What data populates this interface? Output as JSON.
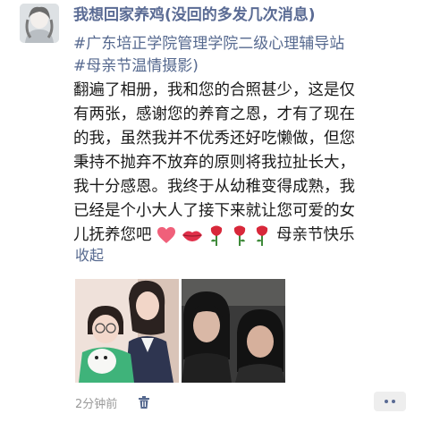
{
  "post": {
    "author": "我想回家养鸡(没回的多发几次消息)",
    "tags": [
      "#广东培正学院管理学院二级心理辅导站",
      "#母亲节温情摄影)"
    ],
    "body_lines": [
      "翻遍了相册，我和您的合照甚少，这是仅",
      "有两张，感谢您的养育之恩，才有了现在",
      "的我，虽然我并不优秀还好吃懒做，但您",
      "秉持不抛弃不放弃的原则将我拉扯长大，",
      "我十分感恩。我终于从幼稚变得成熟，我",
      "已经是个小大人了接下来就让您可爱的女"
    ],
    "last_line_text": "儿抚养您吧",
    "last_line_tail": "母亲节快乐",
    "collapse_label": "收起",
    "time": "2分钟前"
  },
  "icons": [
    "heart-emoji-icon",
    "lips-emoji-icon",
    "rose-emoji-icon",
    "trash-icon",
    "more-icon"
  ],
  "colors": {
    "link": "#56698f",
    "nickname": "#5a6b94",
    "text": "#1a1a1a",
    "meta": "#9a9a9a"
  }
}
